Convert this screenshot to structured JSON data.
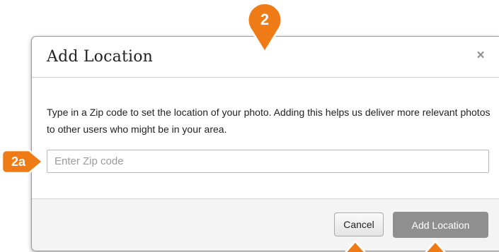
{
  "dialog": {
    "title": "Add Location",
    "close_symbol": "×",
    "description": "Type in a Zip code to set the location of your photo. Adding this helps us deliver more relevant photos to other users who might be in your area.",
    "zip_input": {
      "placeholder": "Enter Zip code",
      "value": ""
    },
    "cancel_label": "Cancel",
    "add_label": "Add Location"
  },
  "callouts": {
    "dialog_marker": "2",
    "input_marker": "2a",
    "color": "#ef7b16"
  },
  "colors": {
    "primary_button": "#8f8f8f",
    "footer_background": "#f4f4f4"
  }
}
